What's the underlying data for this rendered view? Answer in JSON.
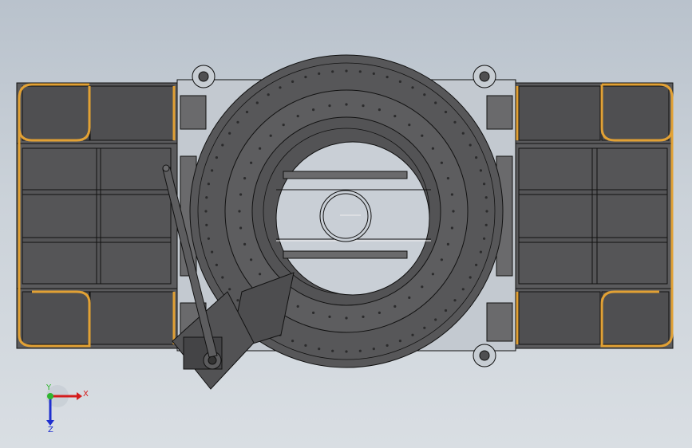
{
  "viewport": {
    "background_top": "#b9c2cc",
    "background_bottom": "#d9dee3"
  },
  "model": {
    "body_color": "#5b5b5d",
    "body_dark": "#444446",
    "edge_color": "#111111",
    "rail_color": "#e2a134",
    "opening_color": "#c9cfd6"
  },
  "triad": {
    "x_label": "X",
    "y_label": "Y",
    "z_label": "Z",
    "x_color": "#d41c1c",
    "y_color": "#2fb52f",
    "z_color": "#1f2fcf"
  }
}
